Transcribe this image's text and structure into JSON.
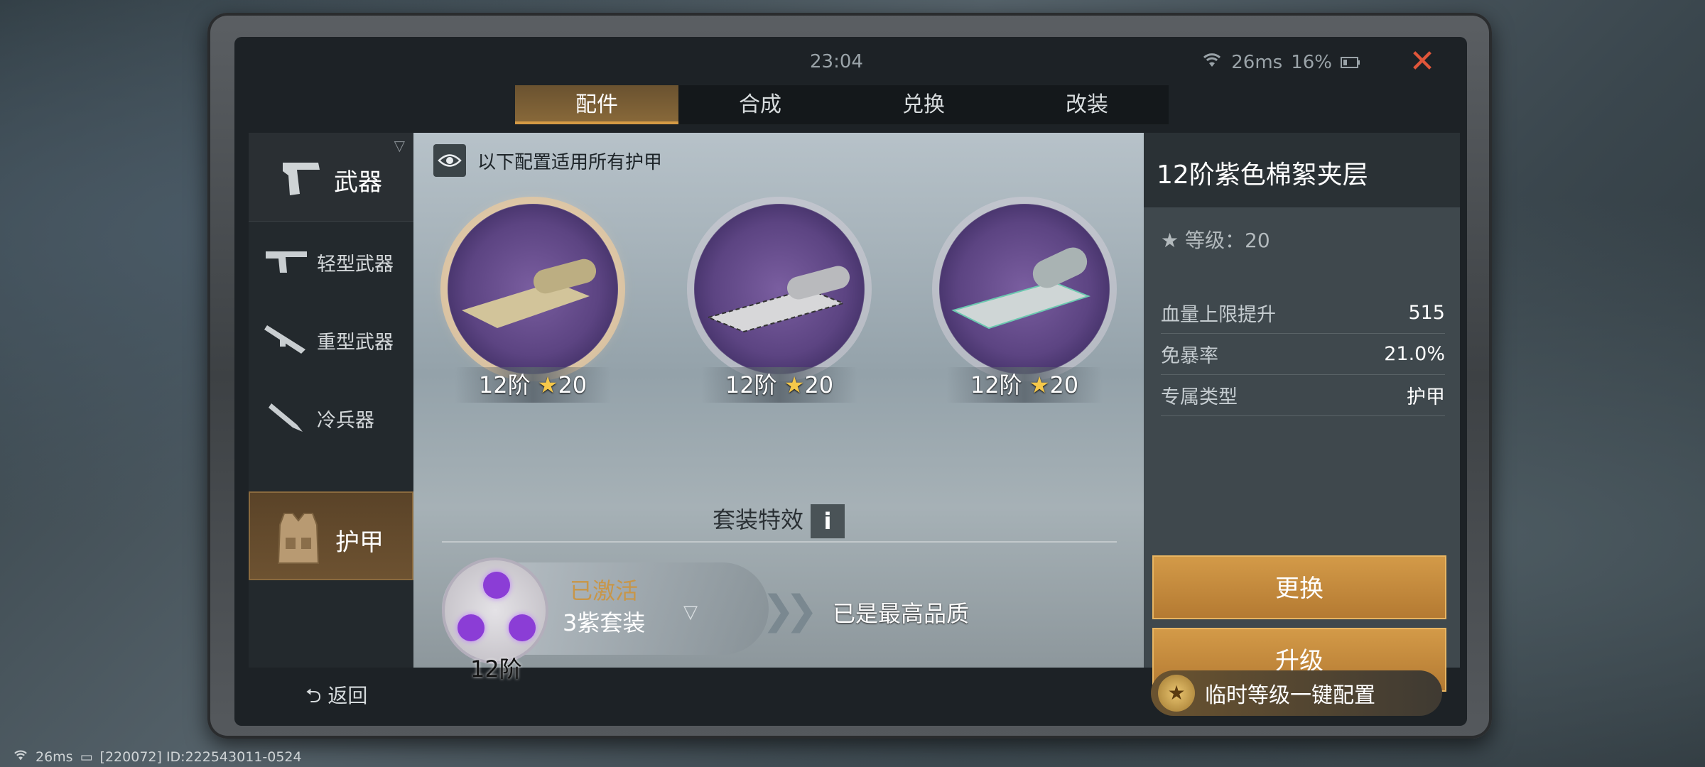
{
  "status": {
    "time": "23:04",
    "ping": "26ms",
    "battery": "16%"
  },
  "tabs": [
    {
      "label": "配件",
      "active": true
    },
    {
      "label": "合成",
      "active": false
    },
    {
      "label": "兑换",
      "active": false
    },
    {
      "label": "改装",
      "active": false
    }
  ],
  "categories": {
    "main": "武器",
    "subs": [
      "轻型武器",
      "重型武器",
      "冷兵器"
    ],
    "armor": "护甲"
  },
  "notice": "以下配置适用所有护甲",
  "items": [
    {
      "tier": "12阶",
      "stars": "20"
    },
    {
      "tier": "12阶",
      "stars": "20"
    },
    {
      "tier": "12阶",
      "stars": "20"
    }
  ],
  "set": {
    "title": "套装特效",
    "info": "i",
    "status": "已激活",
    "name": "3紫套装",
    "level": "12阶",
    "max_note": "已是最高品质"
  },
  "detail": {
    "title": "12阶紫色棉絮夹层",
    "level_line": "等级：20",
    "stats": [
      {
        "k": "血量上限提升",
        "v": "515"
      },
      {
        "k": "免暴率",
        "v": "21.0%"
      },
      {
        "k": "专属类型",
        "v": "护甲"
      }
    ],
    "replace_label": "更换",
    "upgrade_label": "升级"
  },
  "back_label": "返回",
  "oneclick_label": "临时等级一键配置",
  "bottom": {
    "ping": "26ms",
    "id_text": "[220072] ID:222543011-0524"
  },
  "colors": {
    "accent_gold": "#d39a48",
    "purple": "#8b3dd6",
    "close_red": "#e0563a"
  }
}
